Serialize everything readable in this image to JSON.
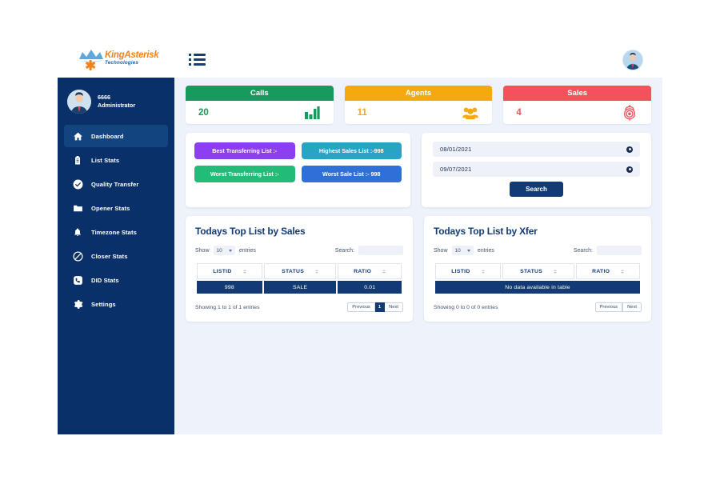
{
  "brand": {
    "name": "KingAsterisk",
    "tagline": "Technologies",
    "logo_icon": "crown-asterisk-logo"
  },
  "topbar": {
    "menu_icon": "hamburger-list-icon",
    "avatar_icon": "user-avatar-icon"
  },
  "sidebar": {
    "user": {
      "id": "6666",
      "role": "Administrator",
      "avatar_icon": "user-avatar-icon"
    },
    "items": [
      {
        "label": "Dashboard",
        "icon": "home-icon",
        "active": true
      },
      {
        "label": "List Stats",
        "icon": "clipboard-icon",
        "active": false
      },
      {
        "label": "Quality Transfer",
        "icon": "check-circle-icon",
        "active": false
      },
      {
        "label": "Opener Stats",
        "icon": "folder-icon",
        "active": false
      },
      {
        "label": "Timezone Stats",
        "icon": "bell-icon",
        "active": false
      },
      {
        "label": "Closer Stats",
        "icon": "ban-circle-icon",
        "active": false
      },
      {
        "label": "DID Stats",
        "icon": "phone-square-icon",
        "active": false
      },
      {
        "label": "Settings",
        "icon": "gear-icon",
        "active": false
      }
    ]
  },
  "stats": [
    {
      "title": "Calls",
      "value": "20",
      "color": "#169a5e",
      "icon": "bar-chart-icon"
    },
    {
      "title": "Agents",
      "value": "11",
      "color": "#f5a90f",
      "icon": "users-icon"
    },
    {
      "title": "Sales",
      "value": "4",
      "color": "#f4515b",
      "icon": "sales-target-icon"
    }
  ],
  "badges": [
    {
      "label": "Best Transferring List :-",
      "color": "#8b3ff0"
    },
    {
      "label": "Highest Sales List :-998",
      "color": "#27a4c4"
    },
    {
      "label": "Worst Transferring List :-",
      "color": "#22bb78"
    },
    {
      "label": "Worst Sale List :- 998",
      "color": "#2f6fd8"
    }
  ],
  "date_filter": {
    "from_date": "08/01/2021",
    "to_date": "09/07/2021",
    "clear_icon": "clear-circle-icon",
    "search_label": "Search"
  },
  "tables": [
    {
      "title": "Todays Top List by Sales",
      "show_label": "Show",
      "entries_label": "entries",
      "page_size": "10",
      "search_label": "Search:",
      "search_value": "",
      "search_placeholder": "",
      "columns": [
        "LISTID",
        "STATUS",
        "RATIO"
      ],
      "rows": [
        [
          "998",
          "SALE",
          "0.01"
        ]
      ],
      "empty_message": "",
      "showing_text": "Showing 1 to 1 of 1 entries",
      "pagination": {
        "previous": "Previous",
        "page": "1",
        "next": "Next",
        "show_page": true
      }
    },
    {
      "title": "Todays Top List by Xfer",
      "show_label": "Show",
      "entries_label": "entries",
      "page_size": "10",
      "search_label": "Search:",
      "search_value": "",
      "search_placeholder": "",
      "columns": [
        "LISTID",
        "STATUS",
        "RATIO"
      ],
      "rows": [],
      "empty_message": "No data available in table",
      "showing_text": "Showing 0 to 0 of 0 entries",
      "pagination": {
        "previous": "Previous",
        "page": "",
        "next": "Next",
        "show_page": false
      }
    }
  ]
}
